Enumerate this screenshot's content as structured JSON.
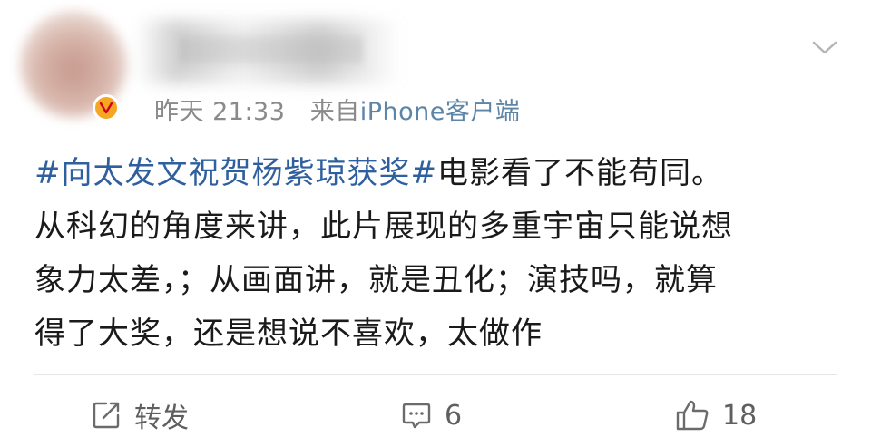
{
  "post": {
    "time": "昨天 21:33",
    "source_prefix": "来自",
    "source": "iPhone客户端",
    "topic": "#向太发文祝贺杨紫琼获奖#",
    "lines": [
      "电影看了不能苟同。",
      "从科幻的角度来讲，此片展现的多重宇宙只能说想",
      "象力太差，；从画面讲，就是丑化；演技吗，就算",
      "得了大奖，还是想说不喜欢，太做作"
    ]
  },
  "actions": {
    "repost_label": "转发",
    "comment_count": "6",
    "like_count": "18"
  },
  "icons": {
    "verified": "verified-badge-icon",
    "more": "chevron-down-icon",
    "repost": "repost-icon",
    "comment": "comment-icon",
    "like": "thumbs-up-icon"
  },
  "colors": {
    "topic": "#2f5f9e",
    "source": "#5d85a8",
    "meta": "#8a8a8a",
    "badge": "#f5a623"
  }
}
